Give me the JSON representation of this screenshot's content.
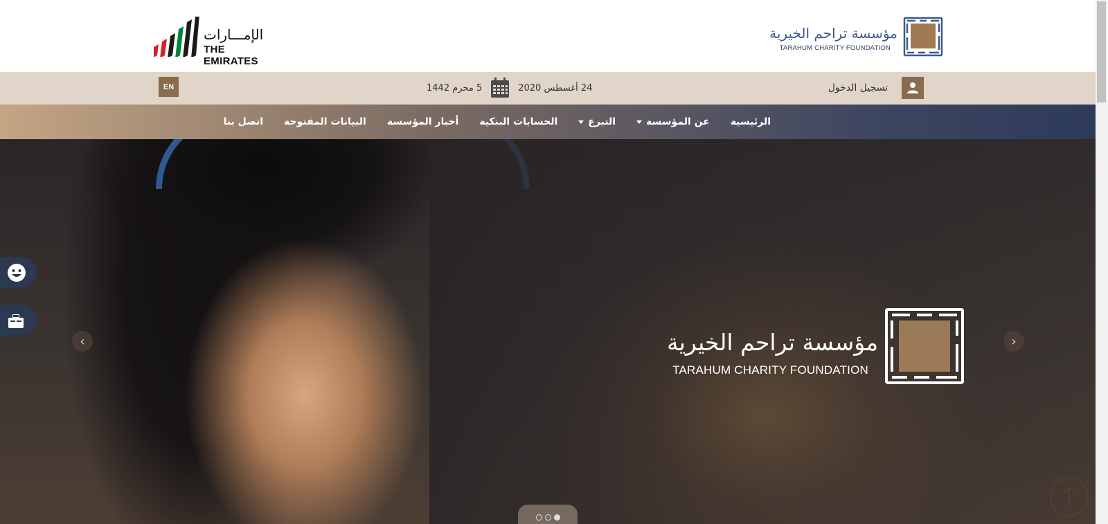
{
  "header": {
    "emirates_logo": {
      "arabic": "الإمـــارات",
      "english": "THE EMIRATES",
      "stripe_colors": [
        "#d62027",
        "#1a1a1a",
        "#00843d",
        "#ffffff"
      ]
    },
    "foundation_logo": {
      "arabic": "مؤسسة تراحم الخيرية",
      "english": "TARAHUM CHARITY FOUNDATION"
    }
  },
  "infobar": {
    "language_button": "EN",
    "date_gregorian": "24 أغسطس 2020",
    "date_hijri": "5 محرم 1442",
    "login_label": "تسجيل الدخول",
    "calendar_icon": "calendar-icon",
    "user_icon": "user-icon"
  },
  "nav": {
    "items": [
      {
        "label": "الرئيسية",
        "dropdown": false
      },
      {
        "label": "عن المؤسسة",
        "dropdown": true
      },
      {
        "label": "التبرع",
        "dropdown": true
      },
      {
        "label": "الحسابات البنكية",
        "dropdown": false
      },
      {
        "label": "أخبار المؤسسة",
        "dropdown": false
      },
      {
        "label": "البيانات المفتوحة",
        "dropdown": false
      },
      {
        "label": "اتصل بنا",
        "dropdown": false
      }
    ]
  },
  "hero": {
    "brand_arabic": "مؤسسة تراحم الخيرية",
    "brand_english": "TARAHUM CHARITY FOUNDATION",
    "slide_count": 3,
    "active_slide": 3
  },
  "floating": {
    "feedback_icon": "smiley-icon",
    "cart_icon": "donation-box-icon",
    "scroll_top_icon": "arrow-up-icon"
  },
  "colors": {
    "brand_brown": "#8b6b4d",
    "infobar_bg": "#e0d5c8",
    "nav_navy": "#2e3a5a",
    "logo_blue": "#3a5a8c"
  }
}
